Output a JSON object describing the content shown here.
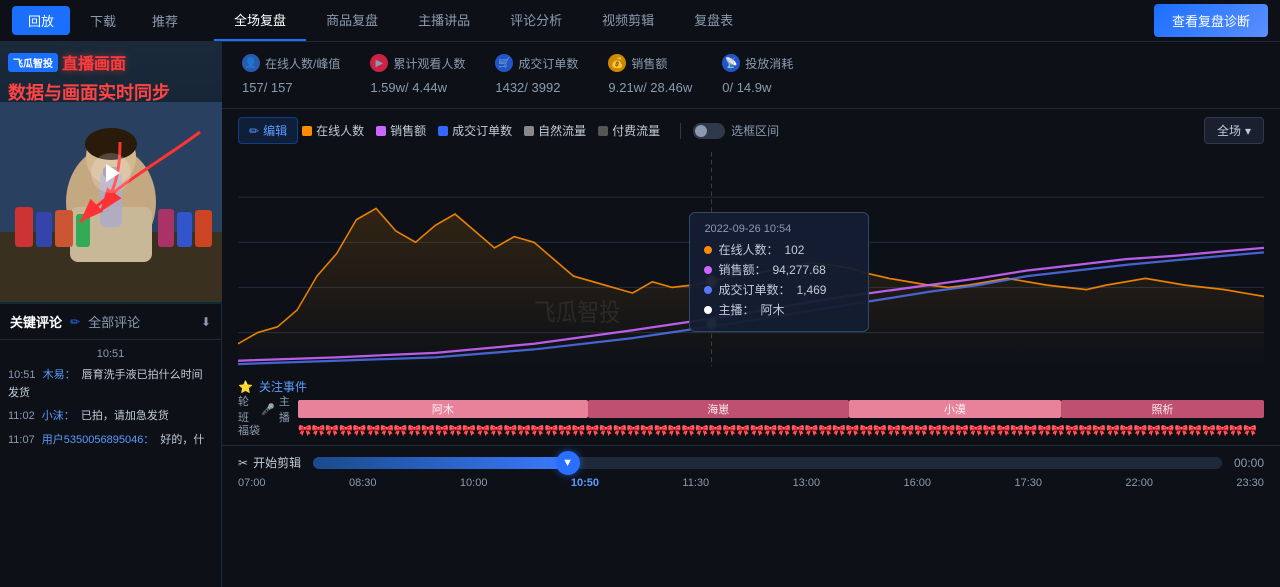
{
  "nav": {
    "playback_label": "回放",
    "download_label": "下载",
    "recommend_label": "推荐",
    "diagnose_label": "查看复盘诊断"
  },
  "tabs": [
    {
      "label": "全场复盘",
      "active": true
    },
    {
      "label": "商品复盘",
      "active": false
    },
    {
      "label": "主播讲品",
      "active": false
    },
    {
      "label": "评论分析",
      "active": false
    },
    {
      "label": "视频剪辑",
      "active": false
    },
    {
      "label": "复盘表",
      "active": false
    }
  ],
  "left": {
    "logo": "飞瓜智投",
    "live_label": "直播画面",
    "sync_label": "数据与画面实时同步",
    "comments_title": "关键评论",
    "edit_icon": "✏",
    "all_comments": "全部评论",
    "comment_time": "10:51",
    "comments": [
      {
        "time": "10:51",
        "user": "木易：",
        "text": "唇育洗手液已拍什么时间发货"
      },
      {
        "time": "11:02",
        "user": "小沫：",
        "text": "已拍，请加急发货"
      },
      {
        "time": "11:07",
        "user": "用户5350056895046：",
        "text": "好的，什"
      }
    ]
  },
  "stats": [
    {
      "icon": "👤",
      "icon_bg": "#2a5aaa",
      "label": "在线人数/峰值",
      "value": "157",
      "sub": "/ 157"
    },
    {
      "icon": "▶",
      "icon_bg": "#cc2244",
      "label": "累计观看人数",
      "value": "1.59w",
      "sub": "/ 4.44w"
    },
    {
      "icon": "🛒",
      "icon_bg": "#2255cc",
      "label": "成交订单数",
      "value": "1432",
      "sub": "/ 3992"
    },
    {
      "icon": "💰",
      "icon_bg": "#cc8800",
      "label": "销售额",
      "value": "9.21w",
      "sub": "/ 28.46w"
    },
    {
      "icon": "📡",
      "icon_bg": "#2255cc",
      "label": "投放消耗",
      "value": "0",
      "sub": "/ 14.9w"
    }
  ],
  "chart_controls": {
    "edit_label": "编辑",
    "legend": [
      {
        "label": "在线人数",
        "color": "#ff8c00",
        "checked": true
      },
      {
        "label": "销售额",
        "color": "#cc66ff",
        "checked": true
      },
      {
        "label": "成交订单数",
        "color": "#3366ff",
        "checked": true
      },
      {
        "label": "自然流量",
        "color": "#888888",
        "checked": true
      },
      {
        "label": "付费流量",
        "color": "#555555",
        "checked": true
      }
    ],
    "range_label": "选框区间",
    "fullscene_label": "全场",
    "chevron": "▾"
  },
  "tooltip": {
    "time": "2022-09-26 10:54",
    "items": [
      {
        "color": "#ff8c00",
        "label": "在线人数：",
        "value": "102"
      },
      {
        "color": "#cc66ff",
        "label": "销售额：",
        "value": "94,277.68"
      },
      {
        "color": "#3366ff",
        "label": "成交订单数：",
        "value": "1,469"
      },
      {
        "color": "#ffffff",
        "label": "主播：",
        "value": "阿木"
      }
    ]
  },
  "events": {
    "title": "关注事件",
    "star_icon": "⭐",
    "rows": [
      {
        "label": "轮班",
        "extra_icon": "🎤",
        "extra_label": "主播",
        "segments": [
          {
            "label": "阿木",
            "color": "#e8829a",
            "left": "0%",
            "width": "30%"
          },
          {
            "label": "海崽",
            "color": "#d0607a",
            "left": "30%",
            "width": "28%"
          },
          {
            "label": "小漠",
            "color": "#e8829a",
            "left": "58%",
            "width": "22%"
          },
          {
            "label": "照析",
            "color": "#d0607a",
            "left": "80%",
            "width": "20%"
          }
        ]
      }
    ],
    "gift_label": "福袋"
  },
  "timeline": {
    "scissor_label": "开始剪辑",
    "times": [
      "07:00",
      "08:30",
      "10:00",
      "10:50",
      "11:30",
      "13:00",
      "16:00",
      "17:30",
      "22:00",
      "23:30",
      "00:00"
    ],
    "active_time": "10:50",
    "progress_pct": 28
  }
}
